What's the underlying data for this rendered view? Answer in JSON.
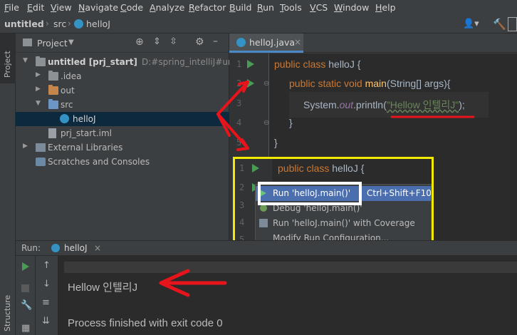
{
  "menu": [
    "File",
    "Edit",
    "View",
    "Navigate",
    "Code",
    "Analyze",
    "Refactor",
    "Build",
    "Run",
    "Tools",
    "VCS",
    "Window",
    "Help"
  ],
  "breadcrumb": {
    "project": "untitled",
    "folder": "src",
    "file": "helloJ"
  },
  "left_stripe": {
    "project_tab": "Project",
    "structure_tab": "Structure"
  },
  "project_panel": {
    "title": "Project",
    "tree": [
      {
        "label": "untitled [prj_start]",
        "path": "D:#spring_intelliJ#untitled"
      },
      {
        "label": ".idea"
      },
      {
        "label": "out"
      },
      {
        "label": "src"
      },
      {
        "label": "helloJ"
      },
      {
        "label": "prj_start.iml"
      },
      {
        "label": "External Libraries"
      },
      {
        "label": "Scratches and Consoles"
      }
    ]
  },
  "editor": {
    "tab": "helloJ.java",
    "lines": [
      {
        "num": "1",
        "kw": "public class",
        "rest": " helloJ {"
      },
      {
        "num": "2",
        "kw": "public static void",
        "fn": "main",
        "rest": "(String[] args){"
      },
      {
        "num": "3",
        "pre": "System.",
        "field": "out",
        "call": ".println(",
        "str": "\"Hellow 인텔리J\"",
        "end": ");"
      },
      {
        "num": "4",
        "rest": "}"
      },
      {
        "num": "5",
        "rest": "}"
      }
    ]
  },
  "popup": {
    "lines": [
      {
        "num": "1",
        "kw": "public class",
        "rest": " helloJ {"
      },
      {
        "num": "2",
        "rest": ""
      },
      {
        "num": "3",
        "rest": ""
      },
      {
        "num": "4",
        "rest": ""
      },
      {
        "num": "5",
        "rest": ""
      }
    ],
    "menu": [
      {
        "label": "Run 'helloJ.main()'",
        "shortcut": "Ctrl+Shift+F10"
      },
      {
        "label": "Debug 'helloJ.main()'",
        "shortcut": ""
      },
      {
        "label": "Run 'helloJ.main()' with Coverage",
        "shortcut": ""
      },
      {
        "label": "Modify Run Configuration...",
        "shortcut": ""
      }
    ]
  },
  "run_panel": {
    "label": "Run:",
    "tab": "helloJ",
    "output_line": "Hellow 인텔리J",
    "exit_line": "Process finished with exit code 0"
  },
  "colors": {
    "annotation_red": "#e8141b",
    "highlight_yellow": "#f2ea00",
    "selection_blue": "#4b6eaf"
  }
}
